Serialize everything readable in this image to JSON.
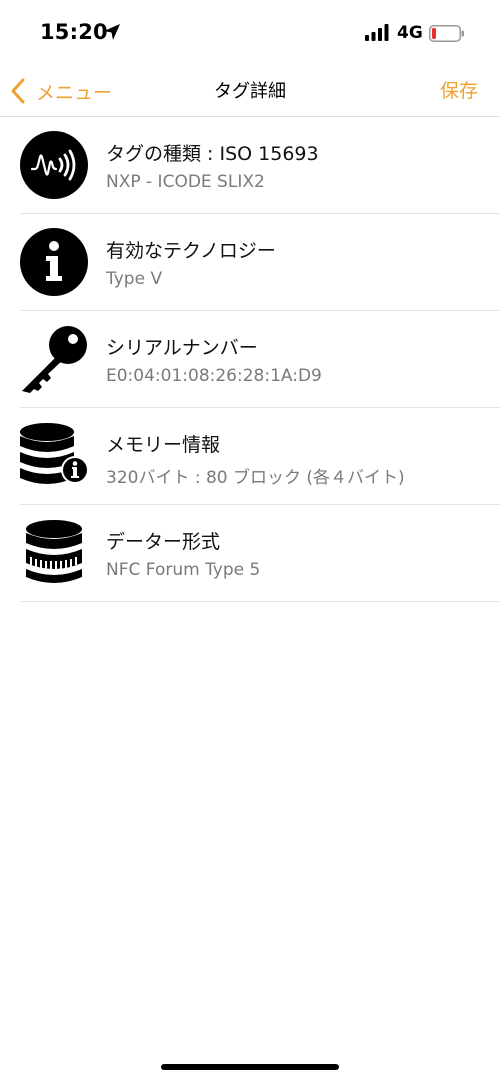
{
  "status_bar": {
    "time": "15:20",
    "network": "4G"
  },
  "nav": {
    "back_label": "メニュー",
    "title": "タグ詳細",
    "save_label": "保存",
    "accent_color": "#f0a030"
  },
  "rows": [
    {
      "icon": "nfc-tag-icon",
      "title": "タグの種類 : ISO 15693",
      "subtitle": "NXP - ICODE SLIX2"
    },
    {
      "icon": "info-icon",
      "title": "有効なテクノロジー",
      "subtitle": "Type V"
    },
    {
      "icon": "key-icon",
      "title": "シリアルナンバー",
      "subtitle": "E0:04:01:08:26:28:1A:D9"
    },
    {
      "icon": "database-info-icon",
      "title": "メモリー情報",
      "subtitle": "320バイト : 80 ブロック (各４バイト)"
    },
    {
      "icon": "database-icon",
      "title": "データー形式",
      "subtitle": "NFC Forum Type 5"
    }
  ]
}
